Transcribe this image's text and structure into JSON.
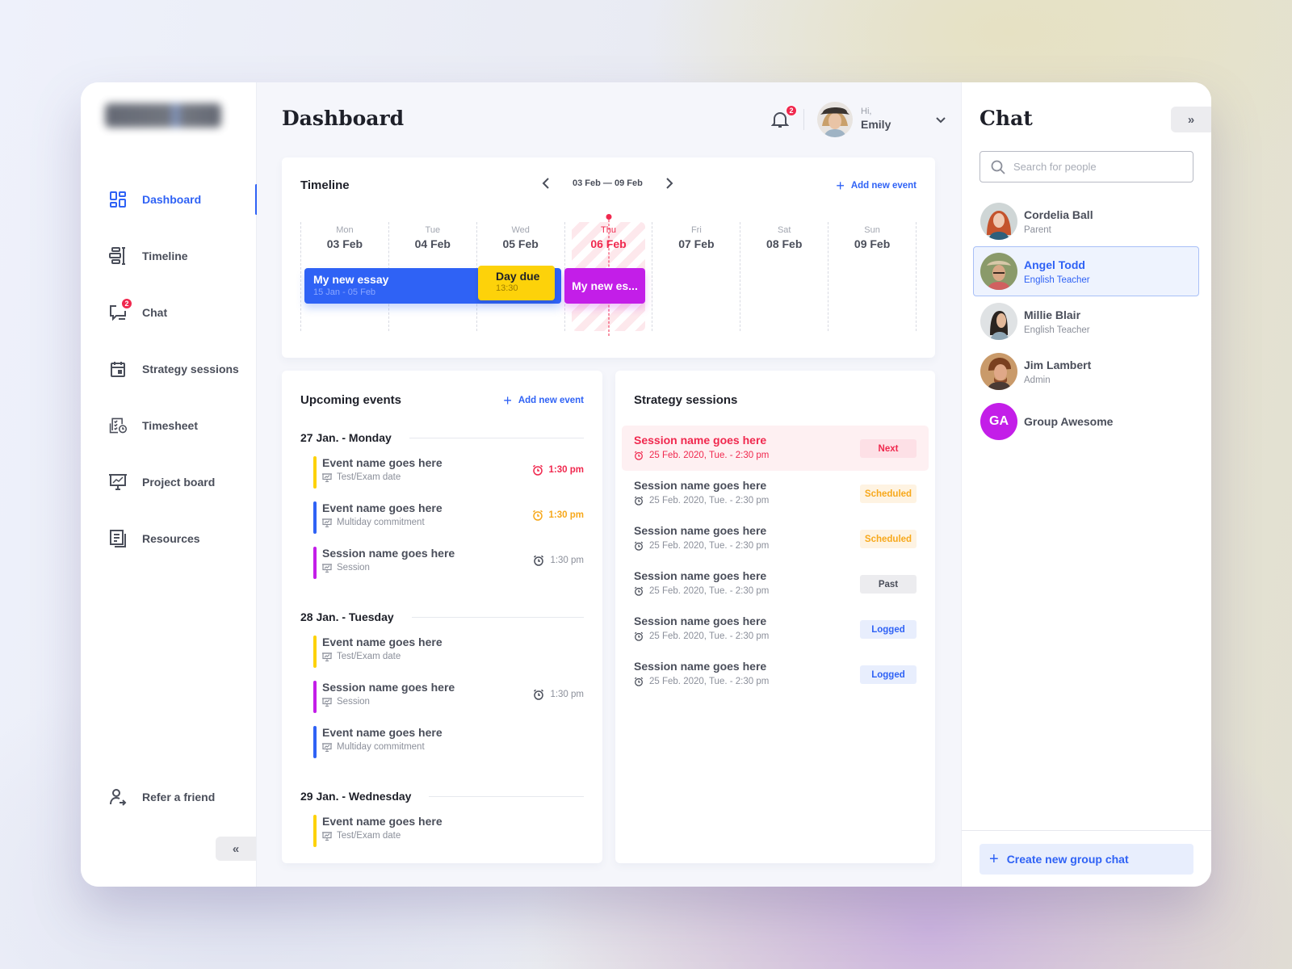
{
  "sidebar": {
    "logo_alt": "Logo (blurred)",
    "items": [
      {
        "label": "Dashboard",
        "icon": "dashboard-icon",
        "active": true
      },
      {
        "label": "Timeline",
        "icon": "timeline-icon"
      },
      {
        "label": "Chat",
        "icon": "chat-icon",
        "badge": "2"
      },
      {
        "label": "Strategy sessions",
        "icon": "calendar-icon"
      },
      {
        "label": "Timesheet",
        "icon": "timesheet-icon"
      },
      {
        "label": "Project board",
        "icon": "presentation-icon"
      },
      {
        "label": "Resources",
        "icon": "document-icon"
      }
    ],
    "refer": {
      "label": "Refer a friend",
      "icon": "refer-user-icon"
    },
    "collapse_label": "«"
  },
  "header": {
    "title": "Dashboard",
    "notifications_count": "2",
    "greeting": "Hi,",
    "user_name": "Emily"
  },
  "timeline": {
    "title": "Timeline",
    "range": "03 Feb — 09 Feb",
    "add_label": "Add new event",
    "days": [
      {
        "dow": "Mon",
        "date": "03 Feb"
      },
      {
        "dow": "Tue",
        "date": "04 Feb"
      },
      {
        "dow": "Wed",
        "date": "05 Feb"
      },
      {
        "dow": "Thu",
        "date": "06 Feb",
        "today": true
      },
      {
        "dow": "Fri",
        "date": "07 Feb"
      },
      {
        "dow": "Sat",
        "date": "08 Feb"
      },
      {
        "dow": "Sun",
        "date": "09 Feb"
      }
    ],
    "events": [
      {
        "title": "My new essay",
        "sub": "15 Jan - 05 Feb",
        "color": "#2f62f5"
      },
      {
        "title": "Day due",
        "sub": "13:30",
        "color": "#fdd20a"
      },
      {
        "title": "My new es...",
        "color": "#c31ee8"
      }
    ]
  },
  "upcoming": {
    "title": "Upcoming events",
    "add_label": "Add new event",
    "groups": [
      {
        "label": "27 Jan. - Monday",
        "items": [
          {
            "name": "Event name goes here",
            "kind": "Test/Exam date",
            "color": "#fdd20a",
            "time": "1:30 pm",
            "time_color": "#f0284e"
          },
          {
            "name": "Event name goes here",
            "kind": "Multiday commitment",
            "color": "#2f62f5",
            "time": "1:30 pm",
            "time_color": "#f7a81b"
          },
          {
            "name": "Session name goes here",
            "kind": "Session",
            "color": "#c31ee8",
            "time": "1:30 pm",
            "time_color": "#8b8f9a"
          }
        ]
      },
      {
        "label": "28 Jan. - Tuesday",
        "items": [
          {
            "name": "Event name goes here",
            "kind": "Test/Exam date",
            "color": "#fdd20a"
          },
          {
            "name": "Session name goes here",
            "kind": "Session",
            "color": "#c31ee8",
            "time": "1:30 pm",
            "time_color": "#8b8f9a"
          },
          {
            "name": "Event name goes here",
            "kind": "Multiday commitment",
            "color": "#2f62f5"
          }
        ]
      },
      {
        "label": "29 Jan. - Wednesday",
        "items": [
          {
            "name": "Event name goes here",
            "kind": "Test/Exam date",
            "color": "#fdd20a"
          }
        ]
      }
    ]
  },
  "strategy": {
    "title": "Strategy sessions",
    "sessions": [
      {
        "name": "Session name goes here",
        "date": "25 Feb. 2020, Tue. - 2:30 pm",
        "status": "Next",
        "bg": "#fde0e6",
        "fg": "#f0284e",
        "highlight": true
      },
      {
        "name": "Session name goes here",
        "date": "25 Feb. 2020, Tue. - 2:30 pm",
        "status": "Scheduled",
        "bg": "#fef3e2",
        "fg": "#f7a81b"
      },
      {
        "name": "Session name goes here",
        "date": "25 Feb. 2020, Tue. - 2:30 pm",
        "status": "Scheduled",
        "bg": "#fef3e2",
        "fg": "#f7a81b"
      },
      {
        "name": "Session name goes here",
        "date": "25 Feb. 2020, Tue. - 2:30 pm",
        "status": "Past",
        "bg": "#ececef",
        "fg": "#4a4e5a"
      },
      {
        "name": "Session name goes here",
        "date": "25 Feb. 2020, Tue. - 2:30 pm",
        "status": "Logged",
        "bg": "#e8eefd",
        "fg": "#2f62f5"
      },
      {
        "name": "Session name goes here",
        "date": "25 Feb. 2020, Tue. - 2:30 pm",
        "status": "Logged",
        "bg": "#e8eefd",
        "fg": "#2f62f5"
      }
    ]
  },
  "chat": {
    "title": "Chat",
    "collapse_label": "»",
    "search_placeholder": "Search for people",
    "people": [
      {
        "name": "Cordelia Ball",
        "role": "Parent",
        "avatar": "photo"
      },
      {
        "name": "Angel Todd",
        "role": "English Teacher",
        "avatar": "photo",
        "selected": true
      },
      {
        "name": "Millie Blair",
        "role": "English Teacher",
        "avatar": "photo"
      },
      {
        "name": "Jim Lambert",
        "role": "Admin",
        "avatar": "photo"
      },
      {
        "name": "Group Awesome",
        "initials": "GA",
        "avatar": "initials"
      }
    ],
    "create_group_label": "Create new group chat"
  },
  "colors": {
    "accent": "#2f62f5",
    "danger": "#f0284e",
    "warning": "#f7a81b",
    "purple": "#c31ee8",
    "yellow": "#fdd20a"
  }
}
